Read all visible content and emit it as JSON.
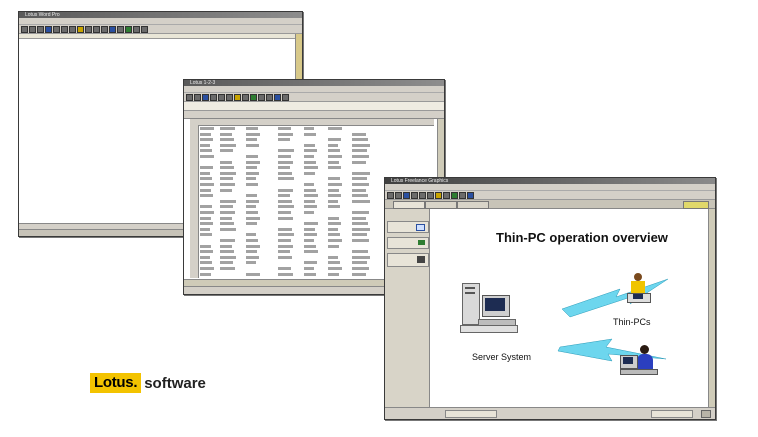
{
  "windows": {
    "wordpro": {
      "title": "Lotus Word Pro"
    },
    "spreadsheet": {
      "title": "Lotus 1-2-3"
    },
    "presentation": {
      "title": "Lotus Freelance Graphics"
    }
  },
  "slide": {
    "title": "Thin-PC operation overview",
    "server_label": "Server System",
    "client_label": "Thin-PCs"
  },
  "logo": {
    "mark": "Lotus.",
    "word": "software"
  },
  "colors": {
    "accent_bolt": "#6dd6ee",
    "logo_yellow": "#f3c300"
  }
}
